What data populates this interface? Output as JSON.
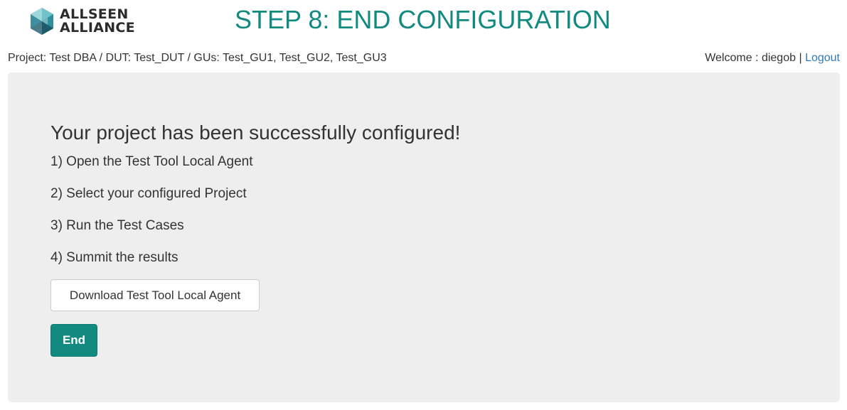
{
  "brand": {
    "line1": "ALLSEEN",
    "line2": "ALLIANCE",
    "icon": "allseen-alliance-logo-icon"
  },
  "header": {
    "title": "STEP 8: END CONFIGURATION"
  },
  "info_bar": {
    "project_info": "Project: Test DBA / DUT: Test_DUT / GUs: Test_GU1, Test_GU2, Test_GU3",
    "welcome": "Welcome : diegob",
    "separator": "|",
    "logout": "Logout"
  },
  "main": {
    "heading": "Your project has been successfully configured!",
    "steps": [
      "1) Open the Test Tool Local Agent",
      "2) Select your configured Project",
      "3) Run the Test Cases",
      "4) Summit the results"
    ],
    "download_label": "Download Test Tool Local Agent",
    "end_label": "End"
  },
  "colors": {
    "accent": "#128a80",
    "panel_bg": "#eeeeee",
    "link": "#337ab7",
    "text": "#333333"
  }
}
